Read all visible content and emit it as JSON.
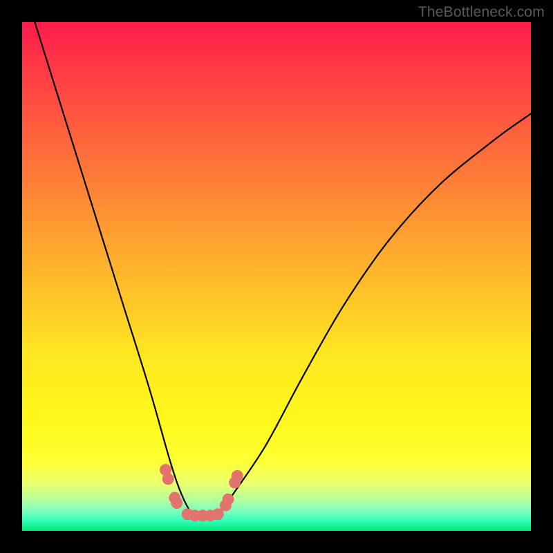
{
  "watermark": "TheBottleneck.com",
  "chart_data": {
    "type": "line",
    "title": "",
    "xlabel": "",
    "ylabel": "",
    "xlim": [
      0,
      100
    ],
    "ylim": [
      0,
      100
    ],
    "series": [
      {
        "name": "bottleneck-curve",
        "x": [
          0,
          5,
          10,
          15,
          20,
          25,
          29,
          31,
          33,
          35,
          37,
          39,
          42,
          48,
          55,
          63,
          72,
          82,
          93,
          100
        ],
        "y": [
          108,
          92,
          76,
          60,
          44,
          28,
          14,
          8,
          4,
          3,
          3,
          4,
          8,
          17,
          30,
          44,
          57,
          68,
          77,
          82
        ]
      }
    ],
    "markers": {
      "name": "highlight-dots",
      "color": "#e3746d",
      "points": [
        {
          "x": 28.2,
          "y": 12.0
        },
        {
          "x": 28.7,
          "y": 10.2
        },
        {
          "x": 30.0,
          "y": 6.5
        },
        {
          "x": 30.4,
          "y": 5.5
        },
        {
          "x": 32.5,
          "y": 3.3
        },
        {
          "x": 34.0,
          "y": 3.0
        },
        {
          "x": 35.5,
          "y": 3.0
        },
        {
          "x": 37.0,
          "y": 3.0
        },
        {
          "x": 38.5,
          "y": 3.3
        },
        {
          "x": 40.0,
          "y": 5.0
        },
        {
          "x": 40.5,
          "y": 6.2
        },
        {
          "x": 41.8,
          "y": 9.5
        },
        {
          "x": 42.3,
          "y": 10.8
        }
      ]
    },
    "gradient_stops": [
      {
        "pos": 0.0,
        "color": "#ff1a4d"
      },
      {
        "pos": 0.5,
        "color": "#ffc428"
      },
      {
        "pos": 0.8,
        "color": "#fff81a"
      },
      {
        "pos": 1.0,
        "color": "#00e878"
      }
    ]
  }
}
